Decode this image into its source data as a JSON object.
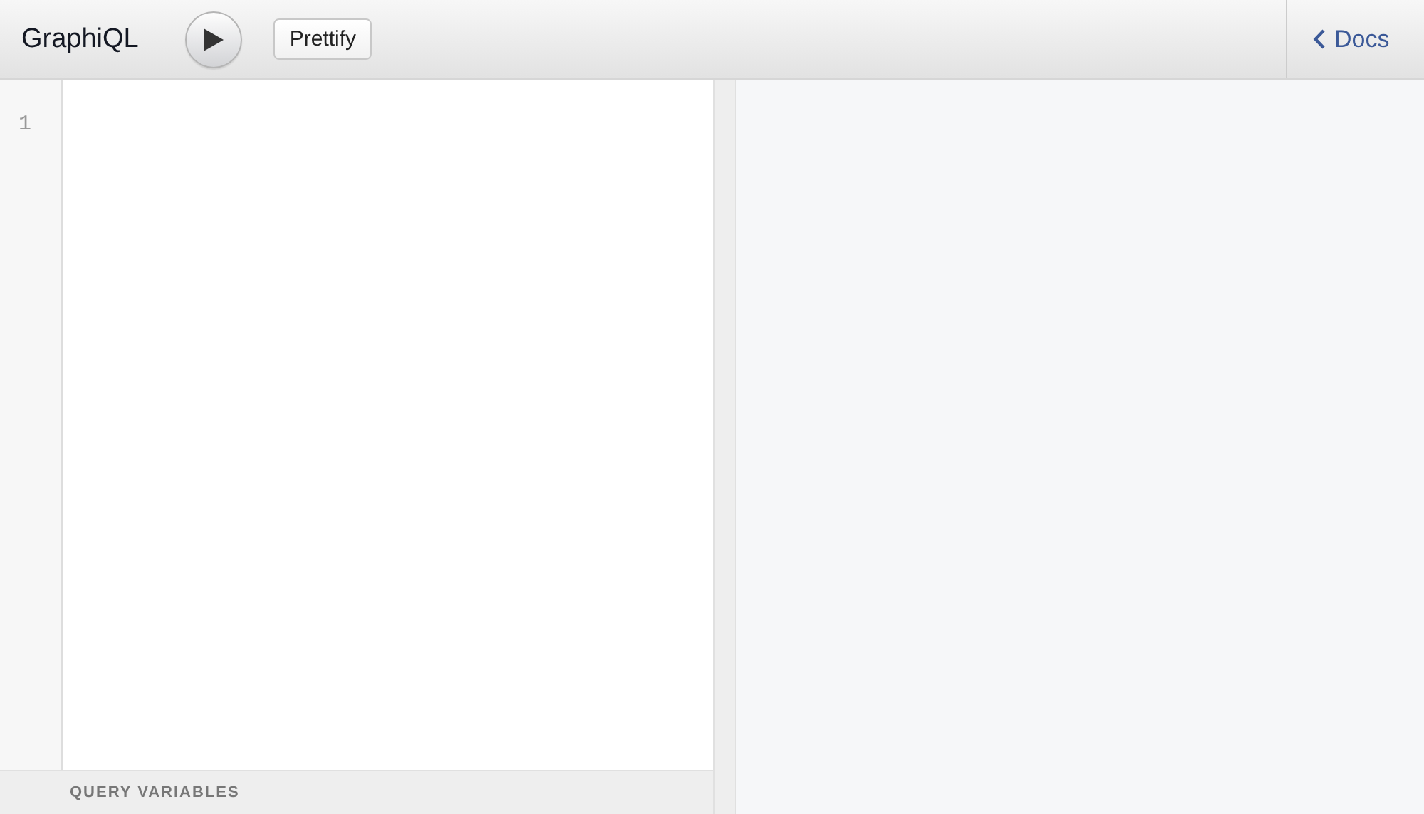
{
  "toolbar": {
    "title": "GraphiQL",
    "buttons": [
      "Prettify"
    ],
    "docs": {
      "label": "Docs"
    }
  },
  "editor": {
    "line_numbers": [
      "1"
    ]
  },
  "variables": {
    "label": "QUERY VARIABLES"
  }
}
